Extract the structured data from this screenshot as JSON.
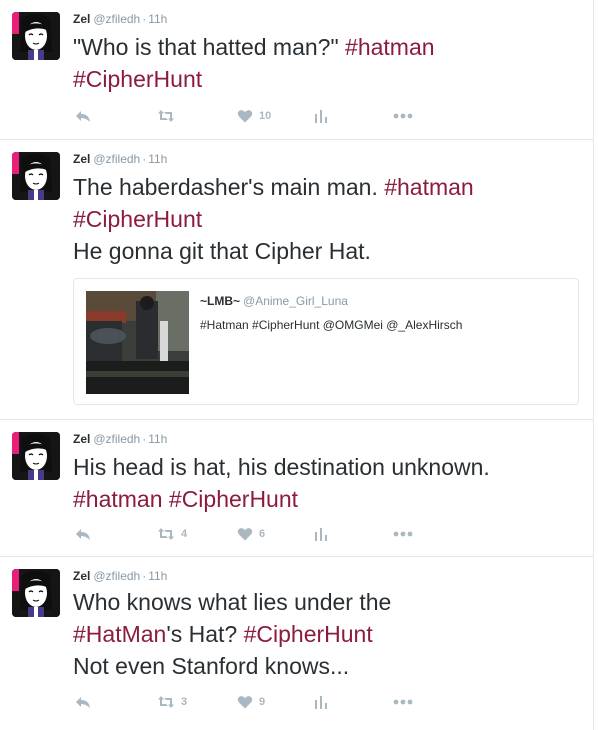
{
  "tweets": [
    {
      "name": "Zel",
      "handle": "@zfiledh",
      "separator": "·",
      "time": "11h",
      "lines": [
        [
          {
            "t": "\"Who is that hatted man?\" ",
            "tag": false
          },
          {
            "t": "#hatman",
            "tag": true
          }
        ],
        [
          {
            "t": "#CipherHunt",
            "tag": true
          }
        ]
      ],
      "retweets": "",
      "likes": "10"
    },
    {
      "name": "Zel",
      "handle": "@zfiledh",
      "separator": "·",
      "time": "11h",
      "lines": [
        [
          {
            "t": "The haberdasher's main man. ",
            "tag": false
          },
          {
            "t": "#hatman",
            "tag": true
          }
        ],
        [
          {
            "t": "#CipherHunt",
            "tag": true
          }
        ],
        [
          {
            "t": "He gonna git that Cipher Hat.",
            "tag": false
          }
        ]
      ],
      "quote": {
        "name": "~LMB~",
        "handle": "@Anime_Girl_Luna",
        "text": "#Hatman #CipherHunt @OMGMei @_AlexHirsch"
      }
    },
    {
      "name": "Zel",
      "handle": "@zfiledh",
      "separator": "·",
      "time": "11h",
      "lines": [
        [
          {
            "t": "His head is hat, his destination unknown.",
            "tag": false
          }
        ],
        [
          {
            "t": "#hatman",
            "tag": true
          },
          {
            "t": " ",
            "tag": false
          },
          {
            "t": "#CipherHunt",
            "tag": true
          }
        ]
      ],
      "retweets": "4",
      "likes": "6"
    },
    {
      "name": "Zel",
      "handle": "@zfiledh",
      "separator": "·",
      "time": "11h",
      "lines": [
        [
          {
            "t": "Who knows what lies under the",
            "tag": false
          }
        ],
        [
          {
            "t": "#HatMan",
            "tag": true
          },
          {
            "t": "'s Hat? ",
            "tag": false
          },
          {
            "t": "#CipherHunt",
            "tag": true
          }
        ],
        [
          {
            "t": "Not even Stanford knows...",
            "tag": false
          }
        ]
      ],
      "retweets": "3",
      "likes": "9"
    }
  ],
  "icons": {
    "reply": "reply-icon",
    "retweet": "retweet-icon",
    "like": "heart-icon",
    "analytics": "analytics-icon",
    "more": "more-icon"
  },
  "colors": {
    "hashtag": "#8b1c3c",
    "icon": "#aab8c2",
    "meta": "#8899a6",
    "border": "#e1e8ed"
  }
}
